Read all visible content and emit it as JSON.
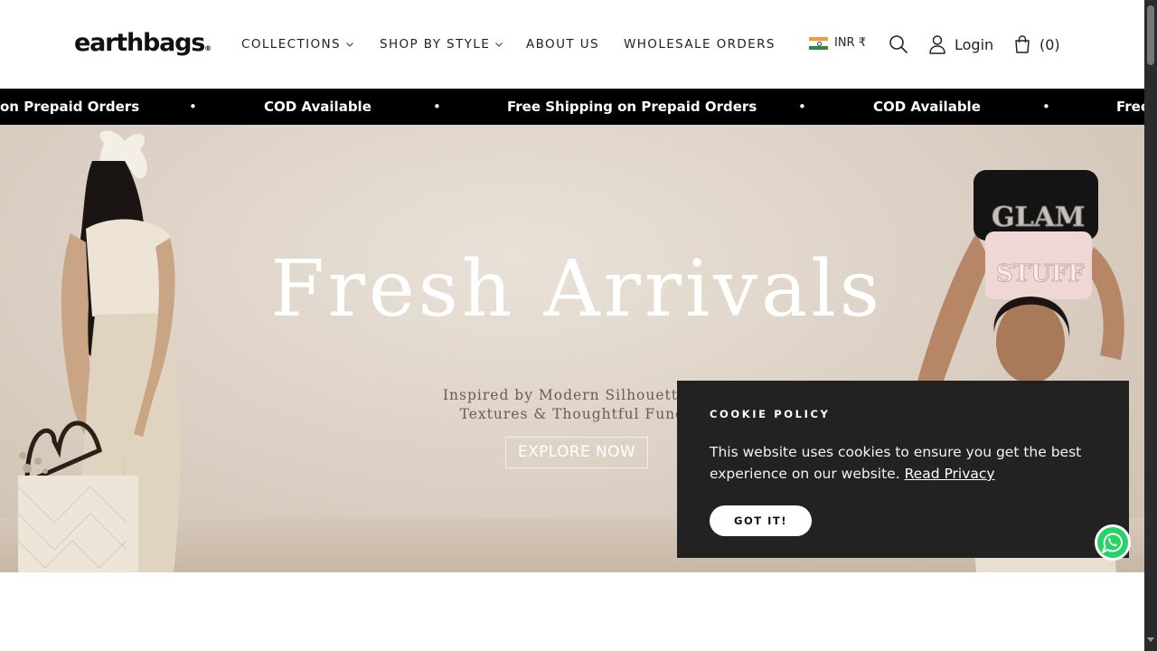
{
  "header": {
    "logo": "earthbags",
    "logo_mark": "®",
    "nav": [
      {
        "label": "COLLECTIONS",
        "has_dropdown": true
      },
      {
        "label": "SHOP BY STYLE",
        "has_dropdown": true
      },
      {
        "label": "ABOUT US",
        "has_dropdown": false
      },
      {
        "label": "WHOLESALE ORDERS",
        "has_dropdown": false
      }
    ],
    "currency": "INR ₹",
    "currency_icon": "india-flag-icon",
    "search_icon": "search-icon",
    "login_label": "Login",
    "login_icon": "user-icon",
    "cart_count": "(0)",
    "cart_icon": "shopping-bag-icon"
  },
  "announcement_bar": {
    "items": [
      "on Prepaid Orders",
      "COD Available",
      "Free Shipping on Prepaid Orders",
      "COD Available",
      "Free"
    ],
    "separator": "•"
  },
  "hero": {
    "title": "Fresh Arrivals",
    "subtitle_line1": "Inspired by Modern Silhouettes, Inn",
    "subtitle_line2": "Textures & Thoughtful Function",
    "cta": "EXPLORE NOW",
    "pouch_top_text": "GLAM",
    "pouch_bottom_text": "STUFF"
  },
  "cookie_banner": {
    "title": "COOKIE POLICY",
    "text": "This website uses cookies to ensure you get the best experience on our website.",
    "link_label": "Read Privacy",
    "button_label": "GOT IT!"
  },
  "floating": {
    "chat_icon": "whatsapp-icon"
  },
  "colors": {
    "announcement_bg": "#000000",
    "cookie_bg": "#222222",
    "hero_bg": "#ddd2c6",
    "hero_sub_text": "#6f5a4d"
  }
}
